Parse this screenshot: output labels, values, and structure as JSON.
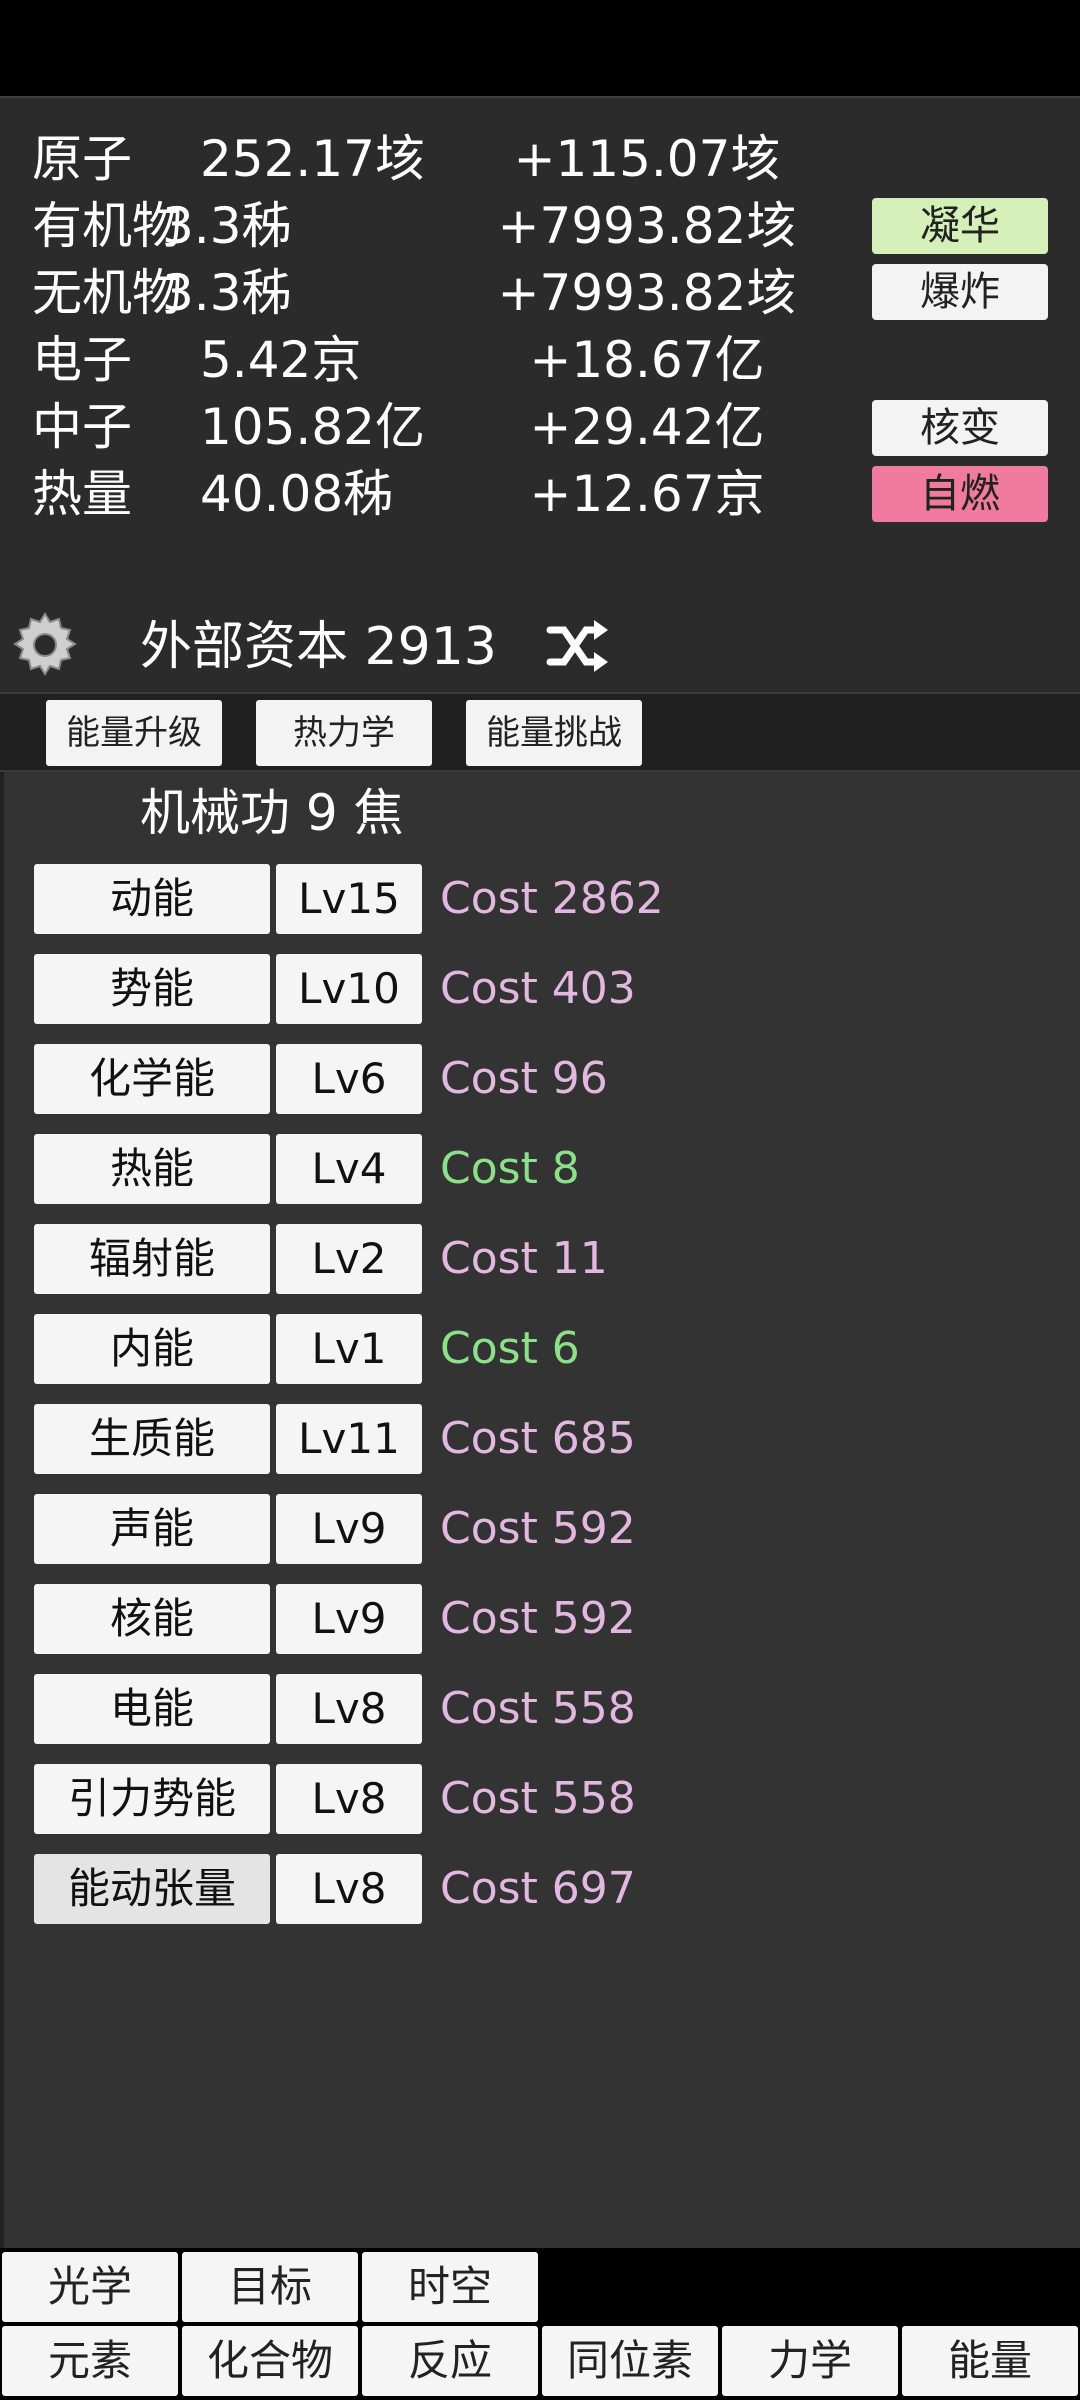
{
  "resources": [
    {
      "name": "原子",
      "value": "252.17垓",
      "rate": "+115.07垓"
    },
    {
      "name": "有机物",
      "value": "3.3秭",
      "rate": "+7993.82垓"
    },
    {
      "name": "无机物",
      "value": "3.3秭",
      "rate": "+7993.82垓"
    },
    {
      "name": "电子",
      "value": "5.42京",
      "rate": "+18.67亿"
    },
    {
      "name": "中子",
      "value": "105.82亿",
      "rate": "+29.42亿"
    },
    {
      "name": "热量",
      "value": "40.08秭",
      "rate": "+12.67京"
    }
  ],
  "side_buttons": {
    "condense": "凝华",
    "explode": "爆炸",
    "fission": "核变",
    "ignite": "自燃",
    "condense_color": "#d4f0b8",
    "ignite_color": "#f07aa0"
  },
  "capital": {
    "label": "外部资本 2913",
    "settings_icon": "gear-icon",
    "shuffle_icon": "shuffle-icon"
  },
  "sub_tabs": [
    "能量升级",
    "热力学",
    "能量挑战"
  ],
  "mechanical_work": "机械功 9 焦",
  "upgrades": [
    {
      "name": "动能",
      "level": "Lv15",
      "cost": "Cost 2862",
      "affordable": false
    },
    {
      "name": "势能",
      "level": "Lv10",
      "cost": "Cost 403",
      "affordable": false
    },
    {
      "name": "化学能",
      "level": "Lv6",
      "cost": "Cost 96",
      "affordable": false
    },
    {
      "name": "热能",
      "level": "Lv4",
      "cost": "Cost 8",
      "affordable": true
    },
    {
      "name": "辐射能",
      "level": "Lv2",
      "cost": "Cost 11",
      "affordable": false
    },
    {
      "name": "内能",
      "level": "Lv1",
      "cost": "Cost 6",
      "affordable": true
    },
    {
      "name": "生质能",
      "level": "Lv11",
      "cost": "Cost 685",
      "affordable": false
    },
    {
      "name": "声能",
      "level": "Lv9",
      "cost": "Cost 592",
      "affordable": false
    },
    {
      "name": "核能",
      "level": "Lv9",
      "cost": "Cost 592",
      "affordable": false
    },
    {
      "name": "电能",
      "level": "Lv8",
      "cost": "Cost 558",
      "affordable": false
    },
    {
      "name": "引力势能",
      "level": "Lv8",
      "cost": "Cost 558",
      "affordable": false
    },
    {
      "name": "能动张量",
      "level": "Lv8",
      "cost": "Cost 697",
      "affordable": false
    }
  ],
  "cost_colors": {
    "affordable": "#8de08a",
    "unaffordable": "#e3b8e0"
  },
  "bottom_tabs_row1": [
    "光学",
    "目标",
    "时空"
  ],
  "bottom_tabs_row2": [
    "元素",
    "化合物",
    "反应",
    "同位素",
    "力学",
    "能量"
  ]
}
